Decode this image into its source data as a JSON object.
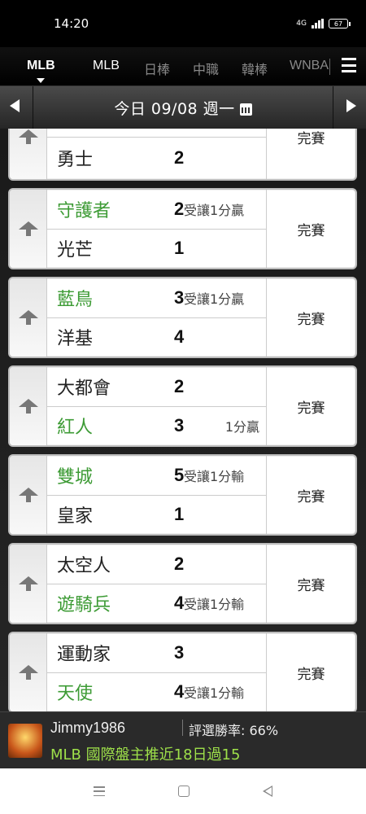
{
  "status_bar": {
    "time": "14:20",
    "network": "4G",
    "battery": "67"
  },
  "tabs": [
    {
      "label": "MLB",
      "active": true
    },
    {
      "label": "MLB",
      "active": false
    },
    {
      "label": "日棒",
      "active": false
    },
    {
      "label": "中職",
      "active": false
    },
    {
      "label": "韓棒",
      "active": false
    },
    {
      "label": "WNBA",
      "active": false
    }
  ],
  "date_bar": {
    "label": "今日 09/08 週一"
  },
  "games": [
    {
      "home": {
        "name": "勇士",
        "score": "2",
        "green": false,
        "note": ""
      },
      "status": "完賽",
      "partial": true
    },
    {
      "away": {
        "name": "守護者",
        "score": "2",
        "green": true,
        "note": "受讓1分贏"
      },
      "home": {
        "name": "光芒",
        "score": "1",
        "green": false,
        "note": ""
      },
      "status": "完賽"
    },
    {
      "away": {
        "name": "藍鳥",
        "score": "3",
        "green": true,
        "note": "受讓1分贏"
      },
      "home": {
        "name": "洋基",
        "score": "4",
        "green": false,
        "note": ""
      },
      "status": "完賽"
    },
    {
      "away": {
        "name": "大都會",
        "score": "2",
        "green": false,
        "note": ""
      },
      "home": {
        "name": "紅人",
        "score": "3",
        "green": true,
        "note": "1分贏"
      },
      "status": "完賽"
    },
    {
      "away": {
        "name": "雙城",
        "score": "5",
        "green": true,
        "note": "受讓1分輸"
      },
      "home": {
        "name": "皇家",
        "score": "1",
        "green": false,
        "note": ""
      },
      "status": "完賽"
    },
    {
      "away": {
        "name": "太空人",
        "score": "2",
        "green": false,
        "note": ""
      },
      "home": {
        "name": "遊騎兵",
        "score": "4",
        "green": true,
        "note": "受讓1分輸"
      },
      "status": "完賽"
    },
    {
      "away": {
        "name": "運動家",
        "score": "3",
        "green": false,
        "note": ""
      },
      "home": {
        "name": "天使",
        "score": "4",
        "green": true,
        "note": "受讓1分輸"
      },
      "status": "完賽"
    }
  ],
  "promo": {
    "user": "Jimmy1986",
    "rate": "評選勝率: 66%",
    "text": "MLB 國際盤主推近18日過15"
  },
  "colors": {
    "green": "#3d9b35",
    "promo_text": "#9ee04a"
  }
}
